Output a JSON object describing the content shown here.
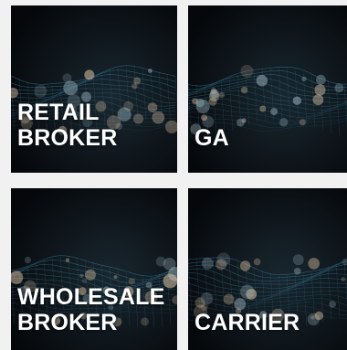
{
  "tiles": [
    {
      "lines": [
        "RETAIL",
        "BROKER"
      ]
    },
    {
      "lines": [
        "GA"
      ]
    },
    {
      "lines": [
        "WHOLESALE",
        "BROKER"
      ]
    },
    {
      "lines": [
        "CARRIER"
      ]
    }
  ],
  "colors": {
    "tile_background": "#05070a",
    "page_background": "#f1f1f2",
    "label_text": "#ffffff",
    "mesh_cyan": "#3a8fb0",
    "bokeh_warm": "#e8c9a8"
  },
  "background_image": "dark-particle-wave-mesh-with-bokeh"
}
